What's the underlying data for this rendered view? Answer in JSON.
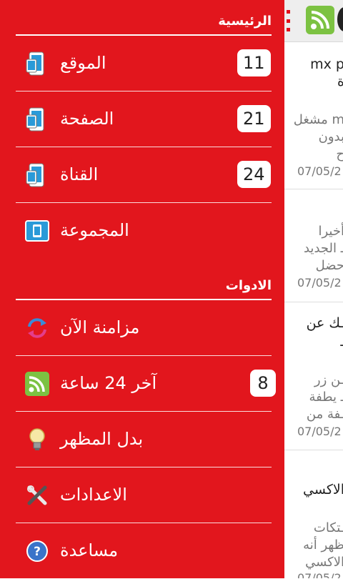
{
  "drawer": {
    "section_main": "الرئيسية",
    "section_tools": "الادوات",
    "main_items": [
      {
        "label": "الموقع",
        "count": "11",
        "icon": "phone-tablet-icon"
      },
      {
        "label": "الصفحة",
        "count": "21",
        "icon": "phone-tablet-icon"
      },
      {
        "label": "القناة",
        "count": "24",
        "icon": "phone-tablet-icon"
      },
      {
        "label": "المجموعة",
        "count": "",
        "icon": "group-tablet-icon"
      }
    ],
    "tool_items": [
      {
        "label": "مزامنة الآن",
        "icon": "sync-icon"
      },
      {
        "label": "آخر 24 ساعة",
        "count": "8",
        "icon": "rss-icon"
      },
      {
        "label": "بدل المظهر",
        "icon": "lightbulb-icon"
      },
      {
        "label": "الاعدادات",
        "icon": "tools-icon"
      },
      {
        "label": "مساعدة",
        "icon": "help-icon"
      }
    ]
  },
  "background": {
    "articles": [
      {
        "title1": "mx p",
        "title2": "ة",
        "snippet1": "m مشغل",
        "snippet2": "بدون",
        "snippet3": "ح",
        "date": "07/05/2"
      },
      {
        "snippet1": "أخيرا",
        "snippet2": "ـ الجديد",
        "snippet3": "حضل",
        "date": "07/05/2"
      },
      {
        "title1": "ـك عن",
        "title2": "ـ",
        "snippet1": "ـن زر",
        "snippet2": "ـ يطفة",
        "snippet3": "ـفة من",
        "date": "07/05/2"
      },
      {
        "title1": "الاكسي",
        "snippet1": "ـتكات",
        "snippet2": "ظهر أنه",
        "snippet3": "الاكسي",
        "date": "07/05/2"
      }
    ]
  },
  "colors": {
    "drawer_bg": "#e2161d",
    "accent": "#e30f1b",
    "rss_green": "#7cc242"
  }
}
